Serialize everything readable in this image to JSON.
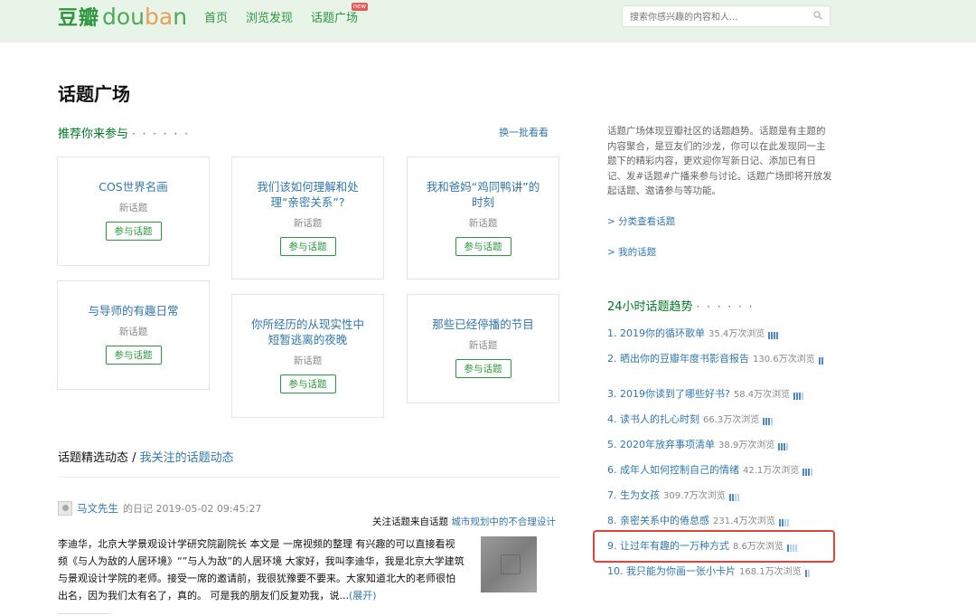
{
  "header": {
    "logo_cn": "豆瓣",
    "logo_en_a": "dou",
    "logo_en_b": "ba",
    "logo_en_c": "n",
    "nav": [
      {
        "label": "首页"
      },
      {
        "label": "浏览发现"
      },
      {
        "label": "话题广场",
        "badge": "new"
      }
    ],
    "search_placeholder": "搜索你感兴趣的内容和人..."
  },
  "page_title": "话题广场",
  "recommend": {
    "title": "推荐你来参与",
    "dots": "· · · · · ·",
    "more": "换一批看看",
    "cards": [
      {
        "title": "COS世界名画",
        "sub": "新话题",
        "button": "参与话题"
      },
      {
        "title": "我们该如何理解和处理“亲密关系”?",
        "sub": "新话题",
        "button": "参与话题"
      },
      {
        "title": "我和爸妈“鸡同鸭讲”的时刻",
        "sub": "新话题",
        "button": "参与话题"
      },
      {
        "title": "与导师的有趣日常",
        "sub": "新话题",
        "button": "参与话题"
      },
      {
        "title": "你所经历的从现实性中短暂逃离的夜晚",
        "sub": "新话题",
        "button": "参与话题"
      },
      {
        "title": "那些已经停播的节目",
        "sub": "新话题",
        "button": "参与话题"
      }
    ]
  },
  "feed": {
    "tab_active": "话题精选动态",
    "sep": " / ",
    "tab_other": "我关注的话题动态",
    "author": "马文先生",
    "meta": "的日记 2019-05-02 09:45:27",
    "from_prefix": "关注话题来自话题",
    "from_topic": "城市规划中的不合理设计",
    "excerpt": "李迪华，北京大学景观设计学研究院副院长 本文是 一席视频的整理 有兴趣的可以直接看视频《与人为敌的人居环境》“”与人为敌”的人居环境 大家好，我叫李迪华，我是北京大学建筑与景观设计学院的老师。接受一席的邀请前，我很犹豫要不要来。大家知道北大的老师很怕出名，因为我们太有名了，真的。 可是我的朋友们反复劝我，说...",
    "expand": "(展开)"
  },
  "sidebar": {
    "intro": "话题广场体现豆瓣社区的话题趋势。话题是有主题的内容聚合，是豆友们的沙龙，你可以在此发现同一主题下的精彩内容，更欢迎你写新日记、添加已有日记、发#话题#广播来参与讨论。话题广场即将开放发起话题、邀请参与等功能。",
    "links": [
      "> 分类查看话题",
      "> 我的话题"
    ],
    "trend_title": "24小时话题趋势",
    "trend_dots": "· · · · · ·",
    "trends": [
      {
        "label": "1. 2019你的循环歌单",
        "views": "35.4万次浏览",
        "bars": 4
      },
      {
        "label": "2. 晒出你的豆瓣年度书影音报告",
        "views": "130.6万次浏览",
        "bars": 2
      },
      {
        "label": "3. 2019你读到了哪些好书?",
        "views": "58.4万次浏览",
        "bars": 4
      },
      {
        "label": "4. 读书人的扎心时刻",
        "views": "66.3万次浏览",
        "bars": 4
      },
      {
        "label": "5. 2020年放弃事项清单",
        "views": "38.9万次浏览",
        "bars": 4
      },
      {
        "label": "6. 成年人如何控制自己的情绪",
        "views": "42.1万次浏览",
        "bars": 4
      },
      {
        "label": "7. 生为女孩",
        "views": "309.7万次浏览",
        "bars": 4
      },
      {
        "label": "8. 亲密关系中的倦怠感",
        "views": "231.4万次浏览",
        "bars": 4
      },
      {
        "label": "9. 让过年有趣的一万种方式",
        "views": "8.6万次浏览",
        "bars": 4
      },
      {
        "label": "10. 我只能为你画一张小卡片",
        "views": "168.1万次浏览",
        "bars": 2
      }
    ]
  },
  "colors": {
    "brand_green": "#2e963d",
    "link_blue": "#37a",
    "header_bg": "#e9f4e9",
    "highlight_red": "#e0433a"
  }
}
